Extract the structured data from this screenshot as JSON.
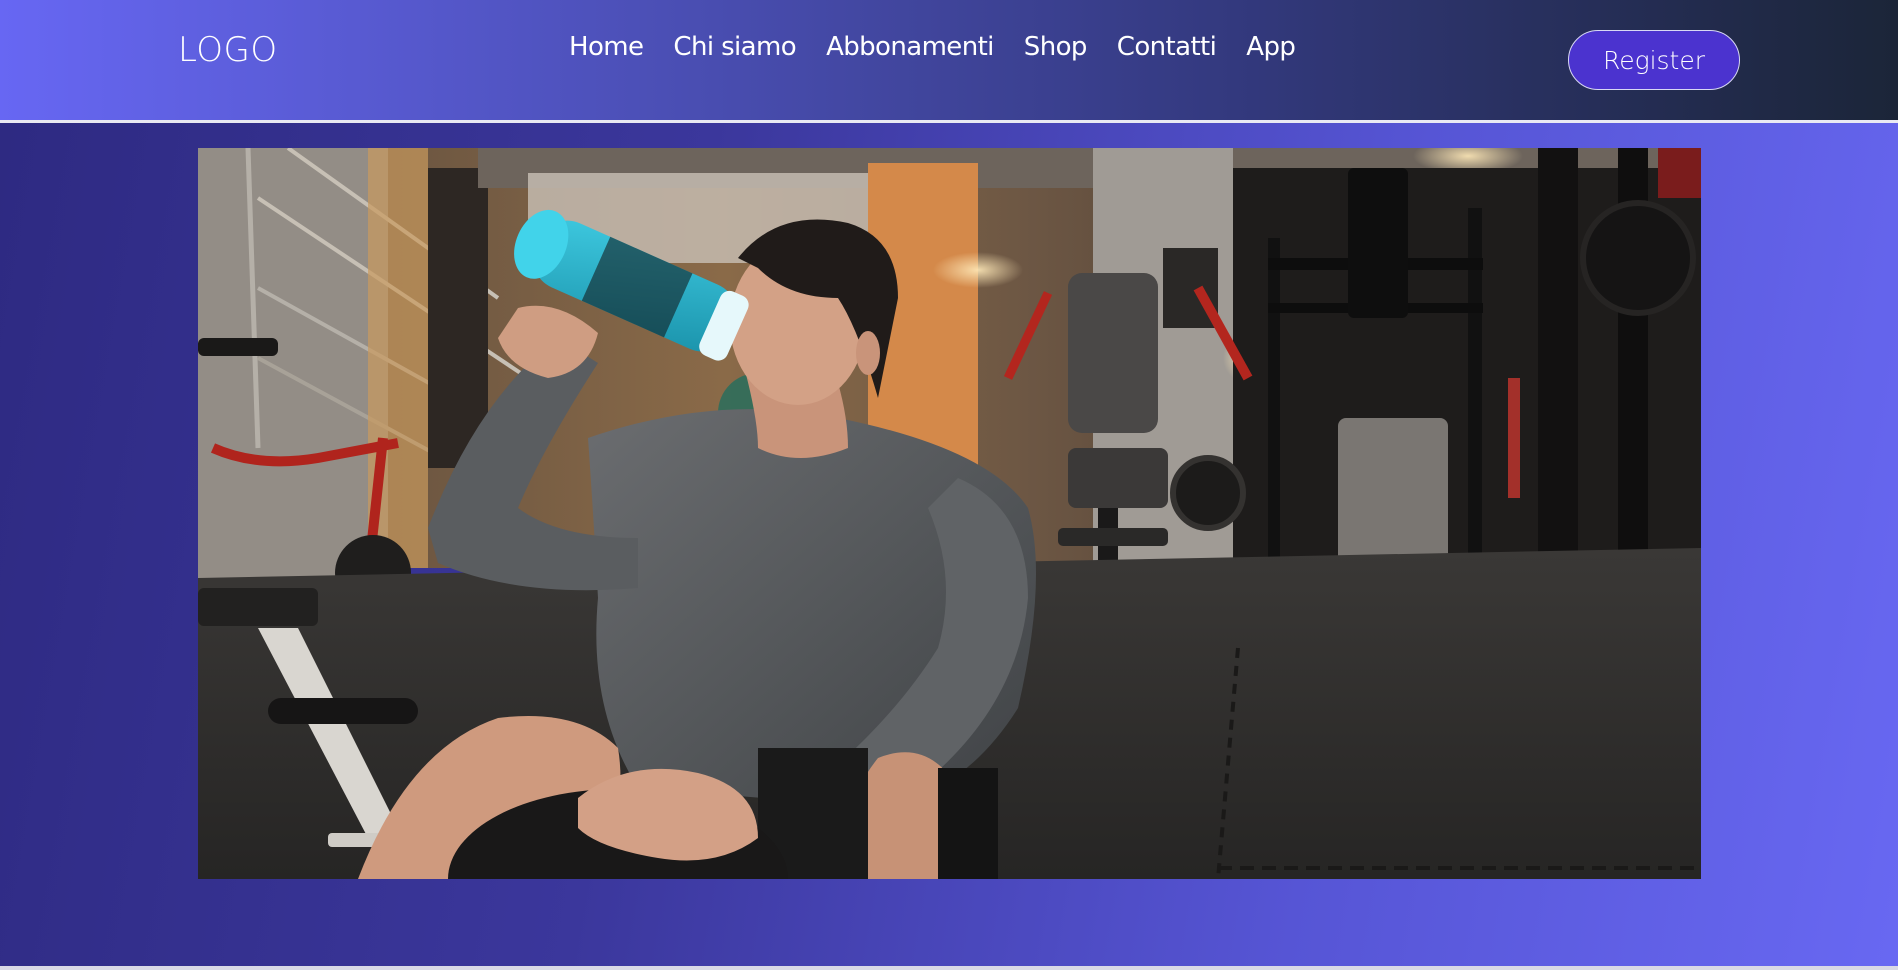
{
  "header": {
    "logo": "LOGO",
    "nav": [
      {
        "label": "Home"
      },
      {
        "label": "Chi siamo"
      },
      {
        "label": "Abbonamenti"
      },
      {
        "label": "Shop"
      },
      {
        "label": "Contatti"
      },
      {
        "label": "App"
      }
    ],
    "register_label": "Register"
  },
  "hero": {
    "image_icon": "gym-photo"
  },
  "colors": {
    "header_gradient_start": "#6767f3",
    "header_gradient_end": "#1b2538",
    "register_button": "#4b33cf",
    "hero_gradient_start": "#2e2a82",
    "hero_gradient_end": "#6868f2"
  }
}
